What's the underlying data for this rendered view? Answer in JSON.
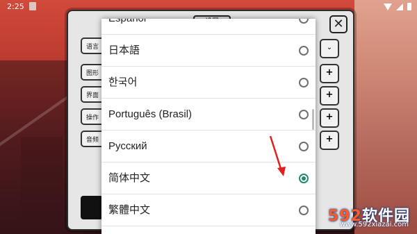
{
  "status_bar": {
    "time": "2:25"
  },
  "settings_panel": {
    "title": "设置",
    "close_label": "✕",
    "rows": [
      {
        "label": "语言"
      },
      {
        "label": "图形"
      },
      {
        "label": "界面"
      },
      {
        "label": "操作"
      },
      {
        "label": "音频"
      }
    ],
    "plus_label": "+",
    "dropdown_arrow": "⌄"
  },
  "language_dialog": {
    "items": [
      {
        "label": "Español",
        "selected": false
      },
      {
        "label": "日本語",
        "selected": false
      },
      {
        "label": "한국어",
        "selected": false
      },
      {
        "label": "Português (Brasil)",
        "selected": false
      },
      {
        "label": "Русский",
        "selected": false
      },
      {
        "label": "简体中文",
        "selected": true
      },
      {
        "label": "繁體中文",
        "selected": false
      }
    ]
  },
  "colors": {
    "radio_selected": "#1f8a70",
    "annotation_arrow": "#e0201c"
  },
  "watermark": {
    "title_num": "592",
    "title_text": "软件园",
    "url": "www.592xiazai.com"
  }
}
